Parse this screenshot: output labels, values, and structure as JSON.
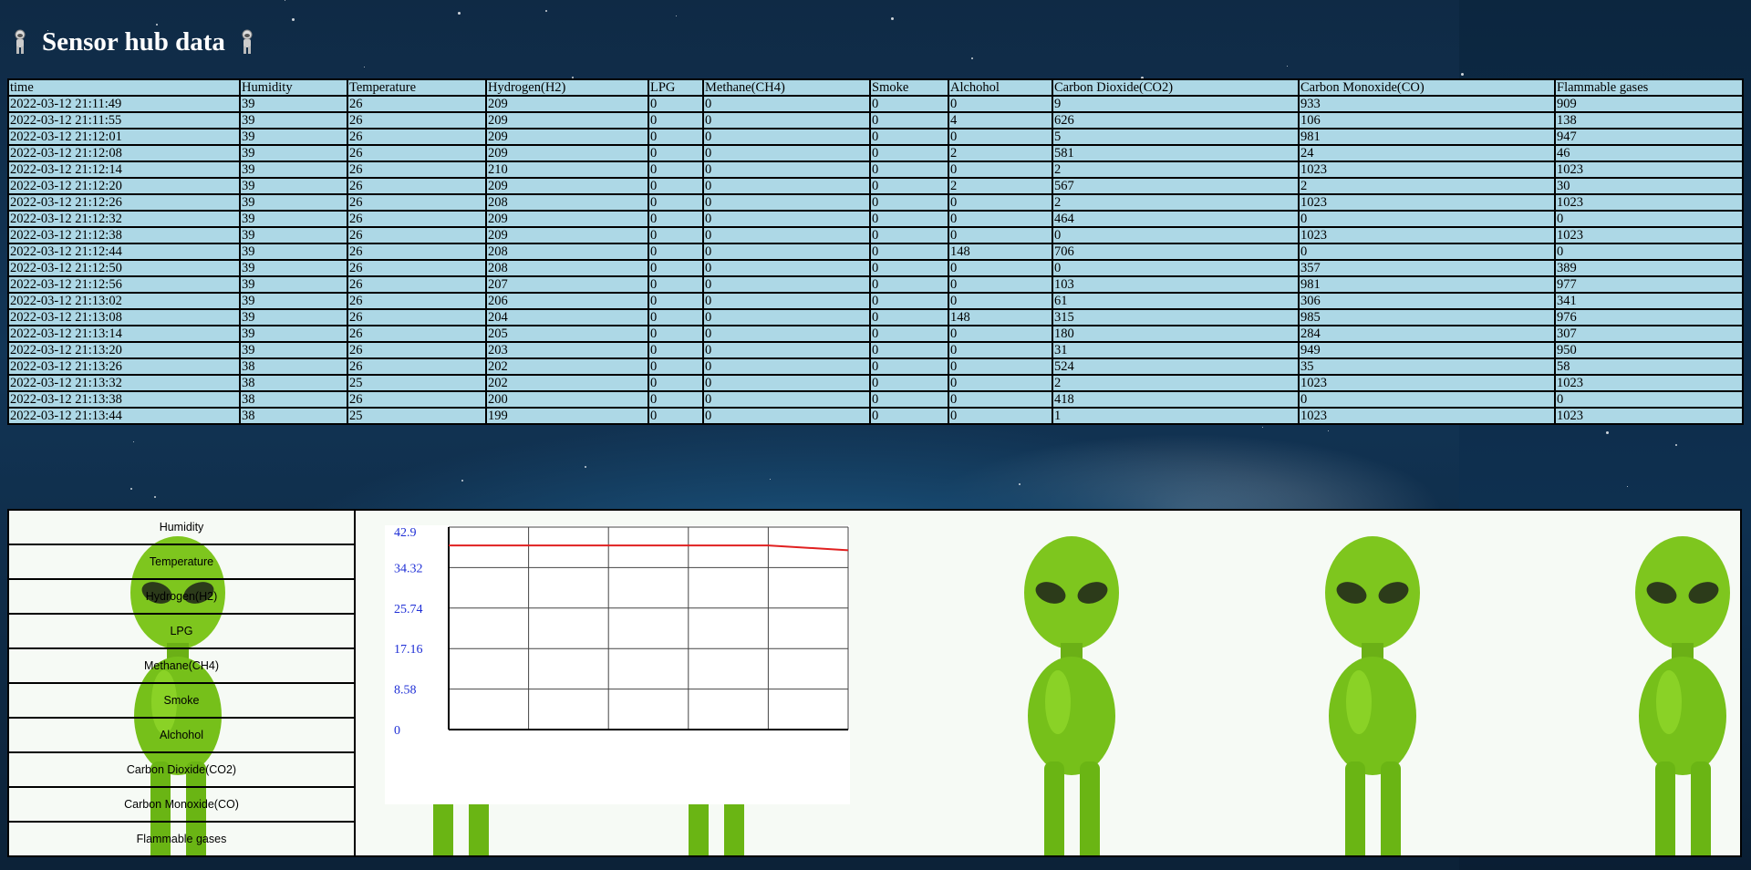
{
  "page": {
    "title": "Sensor hub data"
  },
  "table": {
    "columns": [
      "time",
      "Humidity",
      "Temperature",
      "Hydrogen(H2)",
      "LPG",
      "Methane(CH4)",
      "Smoke",
      "Alchohol",
      "Carbon Dioxide(CO2)",
      "Carbon Monoxide(CO)",
      "Flammable gases"
    ],
    "rows": [
      [
        "2022-03-12 21:11:49",
        "39",
        "26",
        "209",
        "0",
        "0",
        "0",
        "0",
        "9",
        "933",
        "909"
      ],
      [
        "2022-03-12 21:11:55",
        "39",
        "26",
        "209",
        "0",
        "0",
        "0",
        "4",
        "626",
        "106",
        "138"
      ],
      [
        "2022-03-12 21:12:01",
        "39",
        "26",
        "209",
        "0",
        "0",
        "0",
        "0",
        "5",
        "981",
        "947"
      ],
      [
        "2022-03-12 21:12:08",
        "39",
        "26",
        "209",
        "0",
        "0",
        "0",
        "2",
        "581",
        "24",
        "46"
      ],
      [
        "2022-03-12 21:12:14",
        "39",
        "26",
        "210",
        "0",
        "0",
        "0",
        "0",
        "2",
        "1023",
        "1023"
      ],
      [
        "2022-03-12 21:12:20",
        "39",
        "26",
        "209",
        "0",
        "0",
        "0",
        "2",
        "567",
        "2",
        "30"
      ],
      [
        "2022-03-12 21:12:26",
        "39",
        "26",
        "208",
        "0",
        "0",
        "0",
        "0",
        "2",
        "1023",
        "1023"
      ],
      [
        "2022-03-12 21:12:32",
        "39",
        "26",
        "209",
        "0",
        "0",
        "0",
        "0",
        "464",
        "0",
        "0"
      ],
      [
        "2022-03-12 21:12:38",
        "39",
        "26",
        "209",
        "0",
        "0",
        "0",
        "0",
        "0",
        "1023",
        "1023"
      ],
      [
        "2022-03-12 21:12:44",
        "39",
        "26",
        "208",
        "0",
        "0",
        "0",
        "148",
        "706",
        "0",
        "0"
      ],
      [
        "2022-03-12 21:12:50",
        "39",
        "26",
        "208",
        "0",
        "0",
        "0",
        "0",
        "0",
        "357",
        "389"
      ],
      [
        "2022-03-12 21:12:56",
        "39",
        "26",
        "207",
        "0",
        "0",
        "0",
        "0",
        "103",
        "981",
        "977"
      ],
      [
        "2022-03-12 21:13:02",
        "39",
        "26",
        "206",
        "0",
        "0",
        "0",
        "0",
        "61",
        "306",
        "341"
      ],
      [
        "2022-03-12 21:13:08",
        "39",
        "26",
        "204",
        "0",
        "0",
        "0",
        "148",
        "315",
        "985",
        "976"
      ],
      [
        "2022-03-12 21:13:14",
        "39",
        "26",
        "205",
        "0",
        "0",
        "0",
        "0",
        "180",
        "284",
        "307"
      ],
      [
        "2022-03-12 21:13:20",
        "39",
        "26",
        "203",
        "0",
        "0",
        "0",
        "0",
        "31",
        "949",
        "950"
      ],
      [
        "2022-03-12 21:13:26",
        "38",
        "26",
        "202",
        "0",
        "0",
        "0",
        "0",
        "524",
        "35",
        "58"
      ],
      [
        "2022-03-12 21:13:32",
        "38",
        "25",
        "202",
        "0",
        "0",
        "0",
        "0",
        "2",
        "1023",
        "1023"
      ],
      [
        "2022-03-12 21:13:38",
        "38",
        "26",
        "200",
        "0",
        "0",
        "0",
        "0",
        "418",
        "0",
        "0"
      ],
      [
        "2022-03-12 21:13:44",
        "38",
        "25",
        "199",
        "0",
        "0",
        "0",
        "0",
        "1",
        "1023",
        "1023"
      ]
    ]
  },
  "sensor_buttons": [
    "Humidity",
    "Temperature",
    "Hydrogen(H2)",
    "LPG",
    "Methane(CH4)",
    "Smoke",
    "Alchohol",
    "Carbon Dioxide(CO2)",
    "Carbon Monoxide(CO)",
    "Flammable gases"
  ],
  "icons": {
    "header_left": "astronaut-icon",
    "header_right": "astronaut-icon",
    "panel_decor": "dancing-alien-image"
  },
  "colors": {
    "table_bg": "#add8e6",
    "line": "#e02020",
    "tick_text": "#1f2fd6"
  },
  "chart_data": {
    "type": "line",
    "ytick_labels": [
      "42.9",
      "34.32",
      "25.74",
      "17.16",
      "8.58",
      "0"
    ],
    "ylim": [
      0,
      42.9
    ],
    "x": [
      0,
      1,
      2,
      3,
      4,
      5
    ],
    "series": [
      {
        "values": [
          39,
          39,
          39,
          39,
          39,
          38
        ]
      }
    ],
    "grid": true
  }
}
